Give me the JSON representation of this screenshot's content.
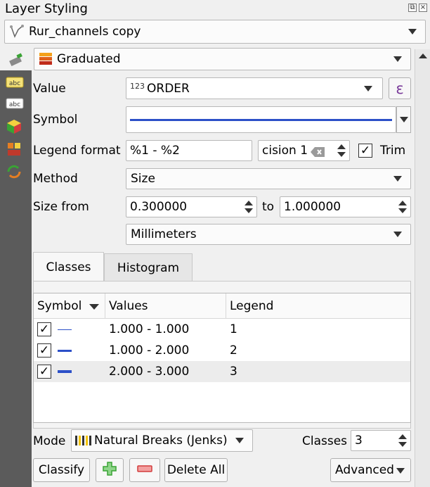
{
  "panel": {
    "title": "Layer Styling"
  },
  "layer_select": {
    "value": "Rur_channels copy",
    "icon": "line-layer-icon"
  },
  "renderer": {
    "value": "Graduated",
    "icon": "graduated-renderer-icon"
  },
  "value_field": {
    "label": "Value",
    "prefix": "123",
    "value": "ORDER",
    "expr_glyph": "ε"
  },
  "symbol": {
    "label": "Symbol",
    "color": "#2c50c8"
  },
  "legend_format": {
    "label": "Legend format",
    "value": "%1 - %2",
    "precision_value": "cision 1",
    "trim_label": "Trim",
    "trim_checked": true
  },
  "method": {
    "label": "Method",
    "value": "Size"
  },
  "size_from": {
    "label": "Size from",
    "from": "0.300000",
    "to_label": "to",
    "to": "1.000000"
  },
  "units": {
    "value": "Millimeters"
  },
  "tabs": [
    {
      "label": "Classes",
      "active": true
    },
    {
      "label": "Histogram",
      "active": false
    }
  ],
  "table": {
    "columns": [
      "Symbol",
      "Values",
      "Legend"
    ],
    "rows": [
      {
        "checked": true,
        "values": "1.000 - 1.000",
        "legend": "1",
        "line_width": 1
      },
      {
        "checked": true,
        "values": "1.000 - 2.000",
        "legend": "2",
        "line_width": 3
      },
      {
        "checked": true,
        "values": "2.000 - 3.000",
        "legend": "3",
        "line_width": 4
      }
    ]
  },
  "mode": {
    "label": "Mode",
    "value": "Natural Breaks (Jenks)",
    "classes_label": "Classes",
    "classes_value": "3"
  },
  "buttons": {
    "classify": "Classify",
    "delete_all": "Delete All",
    "advanced": "Advanced"
  },
  "colors": {
    "toolstrip": "#5b5b5b",
    "accent_blue": "#2c50c8",
    "add_green": "#3aa335",
    "remove_red": "#d23c3c",
    "expr_purple": "#7a3b9a"
  }
}
